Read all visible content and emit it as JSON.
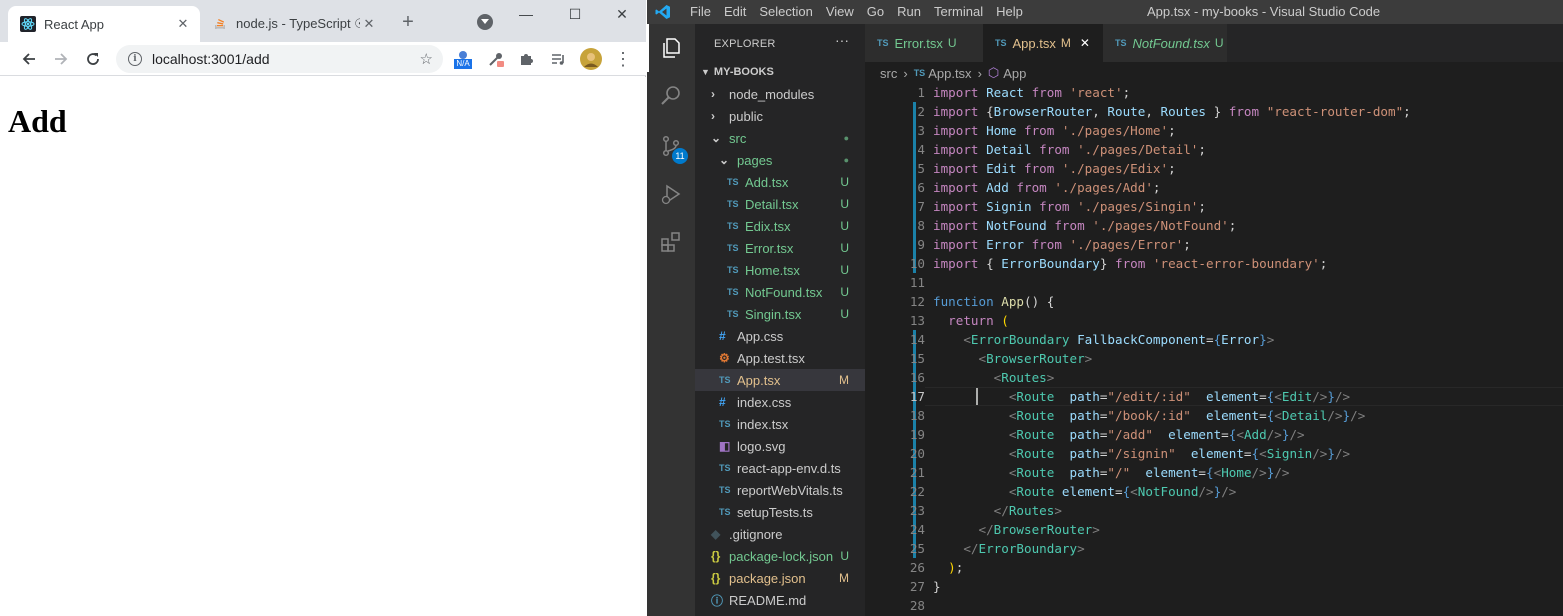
{
  "browser": {
    "tabs": [
      {
        "title": "React App",
        "active": true
      },
      {
        "title": "node.js - TypeScript ☉",
        "active": false
      }
    ],
    "url": "localhost:3001/add",
    "ext_badge": "N/A",
    "page_heading": "Add"
  },
  "vscode": {
    "menu": [
      "File",
      "Edit",
      "Selection",
      "View",
      "Go",
      "Run",
      "Terminal",
      "Help"
    ],
    "window_title": "App.tsx - my-books - Visual Studio Code",
    "explorer_title": "EXPLORER",
    "explorer_more": "···",
    "scm_badge": "11",
    "project": "MY-BOOKS",
    "files": [
      {
        "label": "node_modules",
        "kind": "folder",
        "depth": 1,
        "status": "",
        "color": "#cccccc"
      },
      {
        "label": "public",
        "kind": "folder",
        "depth": 1,
        "status": "",
        "color": "#cccccc"
      },
      {
        "label": "src",
        "kind": "folder-open",
        "depth": 1,
        "status": "●",
        "color": "#73c991"
      },
      {
        "label": "pages",
        "kind": "folder-open",
        "depth": 2,
        "status": "●",
        "color": "#73c991"
      },
      {
        "label": "Add.tsx",
        "kind": "ts",
        "depth": 3,
        "status": "U",
        "color": "#73c991"
      },
      {
        "label": "Detail.tsx",
        "kind": "ts",
        "depth": 3,
        "status": "U",
        "color": "#73c991"
      },
      {
        "label": "Edix.tsx",
        "kind": "ts",
        "depth": 3,
        "status": "U",
        "color": "#73c991"
      },
      {
        "label": "Error.tsx",
        "kind": "ts",
        "depth": 3,
        "status": "U",
        "color": "#73c991"
      },
      {
        "label": "Home.tsx",
        "kind": "ts",
        "depth": 3,
        "status": "U",
        "color": "#73c991"
      },
      {
        "label": "NotFound.tsx",
        "kind": "ts",
        "depth": 3,
        "status": "U",
        "color": "#73c991"
      },
      {
        "label": "Singin.tsx",
        "kind": "ts",
        "depth": 3,
        "status": "U",
        "color": "#73c991"
      },
      {
        "label": "App.css",
        "kind": "css",
        "depth": 2,
        "status": "",
        "color": "#cccccc"
      },
      {
        "label": "App.test.tsx",
        "kind": "test",
        "depth": 2,
        "status": "",
        "color": "#cccccc"
      },
      {
        "label": "App.tsx",
        "kind": "ts",
        "depth": 2,
        "status": "M",
        "color": "#e2c08d",
        "selected": true
      },
      {
        "label": "index.css",
        "kind": "css",
        "depth": 2,
        "status": "",
        "color": "#cccccc"
      },
      {
        "label": "index.tsx",
        "kind": "ts",
        "depth": 2,
        "status": "",
        "color": "#cccccc"
      },
      {
        "label": "logo.svg",
        "kind": "svg",
        "depth": 2,
        "status": "",
        "color": "#cccccc"
      },
      {
        "label": "react-app-env.d.ts",
        "kind": "ts",
        "depth": 2,
        "status": "",
        "color": "#cccccc"
      },
      {
        "label": "reportWebVitals.ts",
        "kind": "ts",
        "depth": 2,
        "status": "",
        "color": "#cccccc"
      },
      {
        "label": "setupTests.ts",
        "kind": "ts",
        "depth": 2,
        "status": "",
        "color": "#cccccc"
      },
      {
        "label": ".gitignore",
        "kind": "git",
        "depth": 1,
        "status": "",
        "color": "#cccccc"
      },
      {
        "label": "package-lock.json",
        "kind": "json",
        "depth": 1,
        "status": "U",
        "color": "#73c991"
      },
      {
        "label": "package.json",
        "kind": "json",
        "depth": 1,
        "status": "M",
        "color": "#e2c08d"
      },
      {
        "label": "README.md",
        "kind": "info",
        "depth": 1,
        "status": "",
        "color": "#cccccc"
      }
    ],
    "editor_tabs": [
      {
        "name": "Error.tsx",
        "status": "U",
        "color": "#73c991",
        "italic": false,
        "active": false
      },
      {
        "name": "App.tsx",
        "status": "M",
        "color": "#e2c08d",
        "italic": false,
        "active": true
      },
      {
        "name": "NotFound.tsx",
        "status": "U",
        "color": "#73c991",
        "italic": true,
        "active": false
      }
    ],
    "breadcrumb": [
      "src",
      "App.tsx",
      "App"
    ],
    "current_line": 17,
    "code_lines": [
      [
        [
          "import ",
          "kw2"
        ],
        [
          "React ",
          "id"
        ],
        [
          "from ",
          "kw2"
        ],
        [
          "'react'",
          "str"
        ],
        [
          ";",
          ""
        ]
      ],
      [
        [
          "import ",
          "kw2"
        ],
        [
          "{",
          ""
        ],
        [
          "BrowserRouter",
          "id"
        ],
        [
          ", ",
          ""
        ],
        [
          "Route",
          "id"
        ],
        [
          ", ",
          ""
        ],
        [
          "Routes",
          "id"
        ],
        [
          " } ",
          ""
        ],
        [
          "from ",
          "kw2"
        ],
        [
          "\"react-router-dom\"",
          "str"
        ],
        [
          ";",
          ""
        ]
      ],
      [
        [
          "import ",
          "kw2"
        ],
        [
          "Home ",
          "id"
        ],
        [
          "from ",
          "kw2"
        ],
        [
          "'./pages/Home'",
          "str"
        ],
        [
          ";",
          ""
        ]
      ],
      [
        [
          "import ",
          "kw2"
        ],
        [
          "Detail ",
          "id"
        ],
        [
          "from ",
          "kw2"
        ],
        [
          "'./pages/Detail'",
          "str"
        ],
        [
          ";",
          ""
        ]
      ],
      [
        [
          "import ",
          "kw2"
        ],
        [
          "Edit ",
          "id"
        ],
        [
          "from ",
          "kw2"
        ],
        [
          "'./pages/Edix'",
          "str"
        ],
        [
          ";",
          ""
        ]
      ],
      [
        [
          "import ",
          "kw2"
        ],
        [
          "Add ",
          "id"
        ],
        [
          "from ",
          "kw2"
        ],
        [
          "'./pages/Add'",
          "str"
        ],
        [
          ";",
          ""
        ]
      ],
      [
        [
          "import ",
          "kw2"
        ],
        [
          "Signin ",
          "id"
        ],
        [
          "from ",
          "kw2"
        ],
        [
          "'./pages/Singin'",
          "str"
        ],
        [
          ";",
          ""
        ]
      ],
      [
        [
          "import ",
          "kw2"
        ],
        [
          "NotFound ",
          "id"
        ],
        [
          "from ",
          "kw2"
        ],
        [
          "'./pages/NotFound'",
          "str"
        ],
        [
          ";",
          ""
        ]
      ],
      [
        [
          "import ",
          "kw2"
        ],
        [
          "Error ",
          "id"
        ],
        [
          "from ",
          "kw2"
        ],
        [
          "'./pages/Error'",
          "str"
        ],
        [
          ";",
          ""
        ]
      ],
      [
        [
          "import ",
          "kw2"
        ],
        [
          "{ ",
          ""
        ],
        [
          "ErrorBoundary",
          "id"
        ],
        [
          "} ",
          ""
        ],
        [
          "from ",
          "kw2"
        ],
        [
          "'react-error-boundary'",
          "str"
        ],
        [
          ";",
          ""
        ]
      ],
      [],
      [
        [
          "function ",
          "kw"
        ],
        [
          "App",
          "fn"
        ],
        [
          "() {",
          ""
        ]
      ],
      [
        [
          "  return ",
          "kw2"
        ],
        [
          "(",
          "br"
        ]
      ],
      [
        [
          "    <",
          "pn"
        ],
        [
          "ErrorBoundary ",
          "tag"
        ],
        [
          "FallbackComponent",
          "id"
        ],
        [
          "=",
          ""
        ],
        [
          "{",
          "kw"
        ],
        [
          "Error",
          "id"
        ],
        [
          "}",
          "kw"
        ],
        [
          ">",
          "pn"
        ]
      ],
      [
        [
          "      <",
          "pn"
        ],
        [
          "BrowserRouter",
          "tag"
        ],
        [
          ">",
          "pn"
        ]
      ],
      [
        [
          "        <",
          "pn"
        ],
        [
          "Routes",
          "tag"
        ],
        [
          ">",
          "pn"
        ]
      ],
      [
        [
          "          <",
          "pn"
        ],
        [
          "Route  ",
          "tag"
        ],
        [
          "path",
          "id"
        ],
        [
          "=",
          ""
        ],
        [
          "\"/edit/:id\"",
          "str"
        ],
        [
          "  element",
          "id"
        ],
        [
          "=",
          ""
        ],
        [
          "{",
          "kw"
        ],
        [
          "<",
          "pn"
        ],
        [
          "Edit",
          "tag"
        ],
        [
          "/>",
          "pn"
        ],
        [
          "}",
          "kw"
        ],
        [
          "/>",
          "pn"
        ]
      ],
      [
        [
          "          <",
          "pn"
        ],
        [
          "Route  ",
          "tag"
        ],
        [
          "path",
          "id"
        ],
        [
          "=",
          ""
        ],
        [
          "\"/book/:id\"",
          "str"
        ],
        [
          "  element",
          "id"
        ],
        [
          "=",
          ""
        ],
        [
          "{",
          "kw"
        ],
        [
          "<",
          "pn"
        ],
        [
          "Detail",
          "tag"
        ],
        [
          "/>",
          "pn"
        ],
        [
          "}",
          "kw"
        ],
        [
          "/>",
          "pn"
        ]
      ],
      [
        [
          "          <",
          "pn"
        ],
        [
          "Route  ",
          "tag"
        ],
        [
          "path",
          "id"
        ],
        [
          "=",
          ""
        ],
        [
          "\"/add\"",
          "str"
        ],
        [
          "  element",
          "id"
        ],
        [
          "=",
          ""
        ],
        [
          "{",
          "kw"
        ],
        [
          "<",
          "pn"
        ],
        [
          "Add",
          "tag"
        ],
        [
          "/>",
          "pn"
        ],
        [
          "}",
          "kw"
        ],
        [
          "/>",
          "pn"
        ]
      ],
      [
        [
          "          <",
          "pn"
        ],
        [
          "Route  ",
          "tag"
        ],
        [
          "path",
          "id"
        ],
        [
          "=",
          ""
        ],
        [
          "\"/signin\"",
          "str"
        ],
        [
          "  element",
          "id"
        ],
        [
          "=",
          ""
        ],
        [
          "{",
          "kw"
        ],
        [
          "<",
          "pn"
        ],
        [
          "Signin",
          "tag"
        ],
        [
          "/>",
          "pn"
        ],
        [
          "}",
          "kw"
        ],
        [
          "/>",
          "pn"
        ]
      ],
      [
        [
          "          <",
          "pn"
        ],
        [
          "Route  ",
          "tag"
        ],
        [
          "path",
          "id"
        ],
        [
          "=",
          ""
        ],
        [
          "\"/\"",
          "str"
        ],
        [
          "  element",
          "id"
        ],
        [
          "=",
          ""
        ],
        [
          "{",
          "kw"
        ],
        [
          "<",
          "pn"
        ],
        [
          "Home",
          "tag"
        ],
        [
          "/>",
          "pn"
        ],
        [
          "}",
          "kw"
        ],
        [
          "/>",
          "pn"
        ]
      ],
      [
        [
          "          <",
          "pn"
        ],
        [
          "Route ",
          "tag"
        ],
        [
          "element",
          "id"
        ],
        [
          "=",
          ""
        ],
        [
          "{",
          "kw"
        ],
        [
          "<",
          "pn"
        ],
        [
          "NotFound",
          "tag"
        ],
        [
          "/>",
          "pn"
        ],
        [
          "}",
          "kw"
        ],
        [
          "/>",
          "pn"
        ]
      ],
      [
        [
          "        </",
          "pn"
        ],
        [
          "Routes",
          "tag"
        ],
        [
          ">",
          "pn"
        ]
      ],
      [
        [
          "      </",
          "pn"
        ],
        [
          "BrowserRouter",
          "tag"
        ],
        [
          ">",
          "pn"
        ]
      ],
      [
        [
          "    </",
          "pn"
        ],
        [
          "ErrorBoundary",
          "tag"
        ],
        [
          ">",
          "pn"
        ]
      ],
      [
        [
          "  ",
          ""
        ],
        [
          ")",
          "br"
        ],
        [
          ";",
          ""
        ]
      ],
      [
        [
          "}",
          ""
        ]
      ],
      []
    ]
  }
}
